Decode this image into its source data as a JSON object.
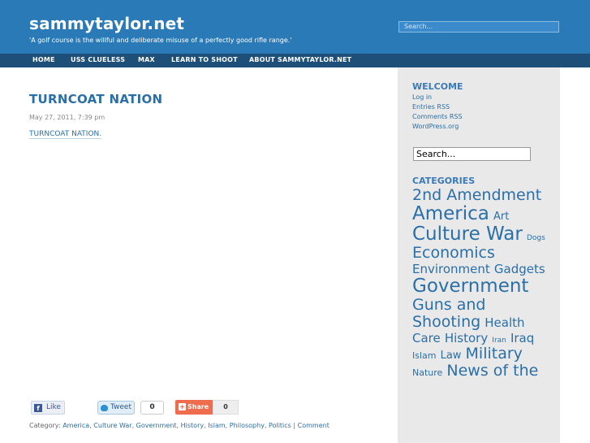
{
  "header": {
    "title": "sammytaylor.net",
    "tagline": "'A golf course is the willful and deliberate misuse of a perfectly good rifle range.'",
    "search_placeholder": "Search..."
  },
  "nav": {
    "items": [
      "HOME",
      "USS CLUELESS",
      "MAX",
      "LEARN TO SHOOT",
      "ABOUT SAMMYTAYLOR.NET"
    ]
  },
  "post": {
    "title": "TURNCOAT NATION",
    "date": "May 27, 2011, 7:39 pm",
    "link_text": "TURNCOAT NATION",
    "link_suffix": "."
  },
  "social": {
    "like_label": "Like",
    "tweet_label": "Tweet",
    "tweet_count": "0",
    "share_label": "Share",
    "share_count": "0"
  },
  "post_footer": {
    "category_prefix": "Category:",
    "categories": [
      "America",
      "Culture War",
      "Government",
      "History",
      "Islam",
      "Philosophy",
      "Politics"
    ],
    "separator": "|",
    "comment_label": "Comment"
  },
  "sidebar": {
    "welcome_title": "WELCOME",
    "meta_links": [
      "Log in",
      "Entries RSS",
      "Comments RSS",
      "WordPress.org"
    ],
    "search_value": "Search...",
    "categories_title": "CATEGORIES",
    "tag_cloud": [
      {
        "label": "2nd Amendment",
        "level": 5
      },
      {
        "label": "America",
        "level": 6
      },
      {
        "label": "Art",
        "level": 3
      },
      {
        "label": "Culture War",
        "level": 6
      },
      {
        "label": "Dogs",
        "level": 1
      },
      {
        "label": "Economics",
        "level": 5
      },
      {
        "label": "Environment",
        "level": 4
      },
      {
        "label": "Gadgets",
        "level": 4
      },
      {
        "label": "Government",
        "level": 6
      },
      {
        "label": "Guns and Shooting",
        "level": 5
      },
      {
        "label": "Health Care",
        "level": 4
      },
      {
        "label": "History",
        "level": 4
      },
      {
        "label": "Iran",
        "level": 1
      },
      {
        "label": "Iraq",
        "level": 4
      },
      {
        "label": "Islam",
        "level": 2
      },
      {
        "label": "Law",
        "level": 3
      },
      {
        "label": "Military",
        "level": 5
      },
      {
        "label": "Nature",
        "level": 2
      },
      {
        "label": "News of the",
        "level": 5
      }
    ]
  },
  "colors": {
    "header_bg": "#2a7ab8",
    "nav_bg": "#1d4f78",
    "link": "#2a6fa8",
    "sidebar_bg": "#e9e9e9"
  }
}
